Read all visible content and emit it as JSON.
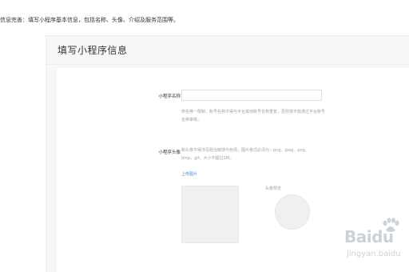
{
  "instruction": "信息完善：填写小程序基本信息，包括名称、头像、介绍及服务范围等。",
  "panel": {
    "title": "填写小程序信息"
  },
  "form": {
    "name_label": "小程序名称",
    "name_value": "",
    "name_hint": "命名唯一限制：账号名称不得与平台其他账号名称重复，否则将不能通过平台账号名称审核。",
    "avatar_label": "小程序头像",
    "avatar_hint": "新头像不得涉及政治敏感与色情，图片格式必须为：png、jpeg、png、bmp、gif，大小不超过2M。",
    "upload_label": "上传图片",
    "preview_label": "头像预览"
  },
  "watermark": {
    "brand": "Baidu",
    "sub": "jingyan.baidu"
  },
  "colors": {
    "link": "#4a8ad6",
    "hint": "#a3a3a3",
    "panel_bg": "#f6f7f9"
  }
}
